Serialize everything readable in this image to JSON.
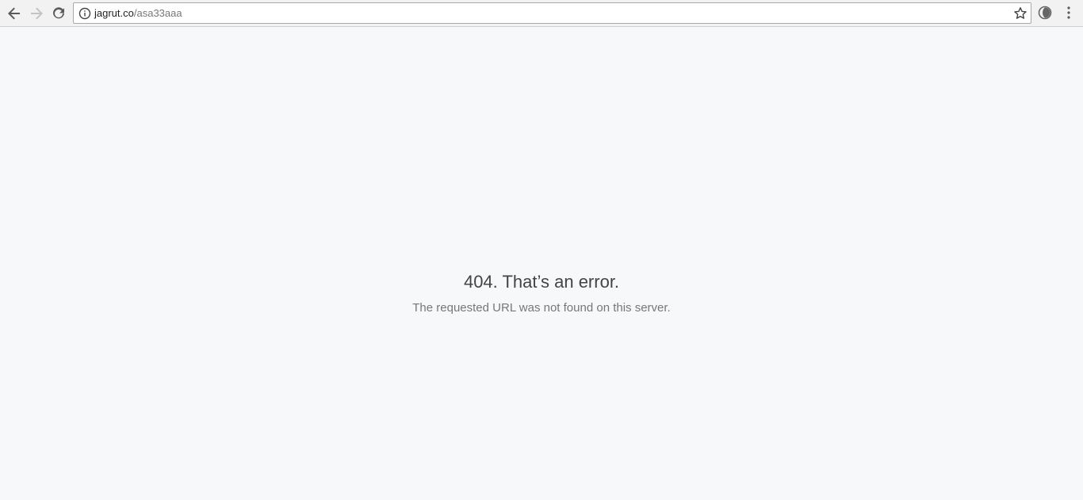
{
  "browser": {
    "nav": {
      "back_icon": "arrow-left-icon",
      "forward_icon": "arrow-right-icon",
      "reload_icon": "reload-icon"
    },
    "omnibox": {
      "security_icon": "info-icon",
      "url_host": "jagrut.co",
      "url_path": "/asa33aaa",
      "bookmark_icon": "star-icon"
    },
    "extension_icon": "extension-icon",
    "menu_icon": "kebab-menu-icon"
  },
  "page": {
    "title": "404. That’s an error.",
    "message": "The requested URL was not found on this server."
  },
  "colors": {
    "page_background": "#f7f8fa",
    "title_text": "#444444",
    "message_text": "#777777"
  }
}
